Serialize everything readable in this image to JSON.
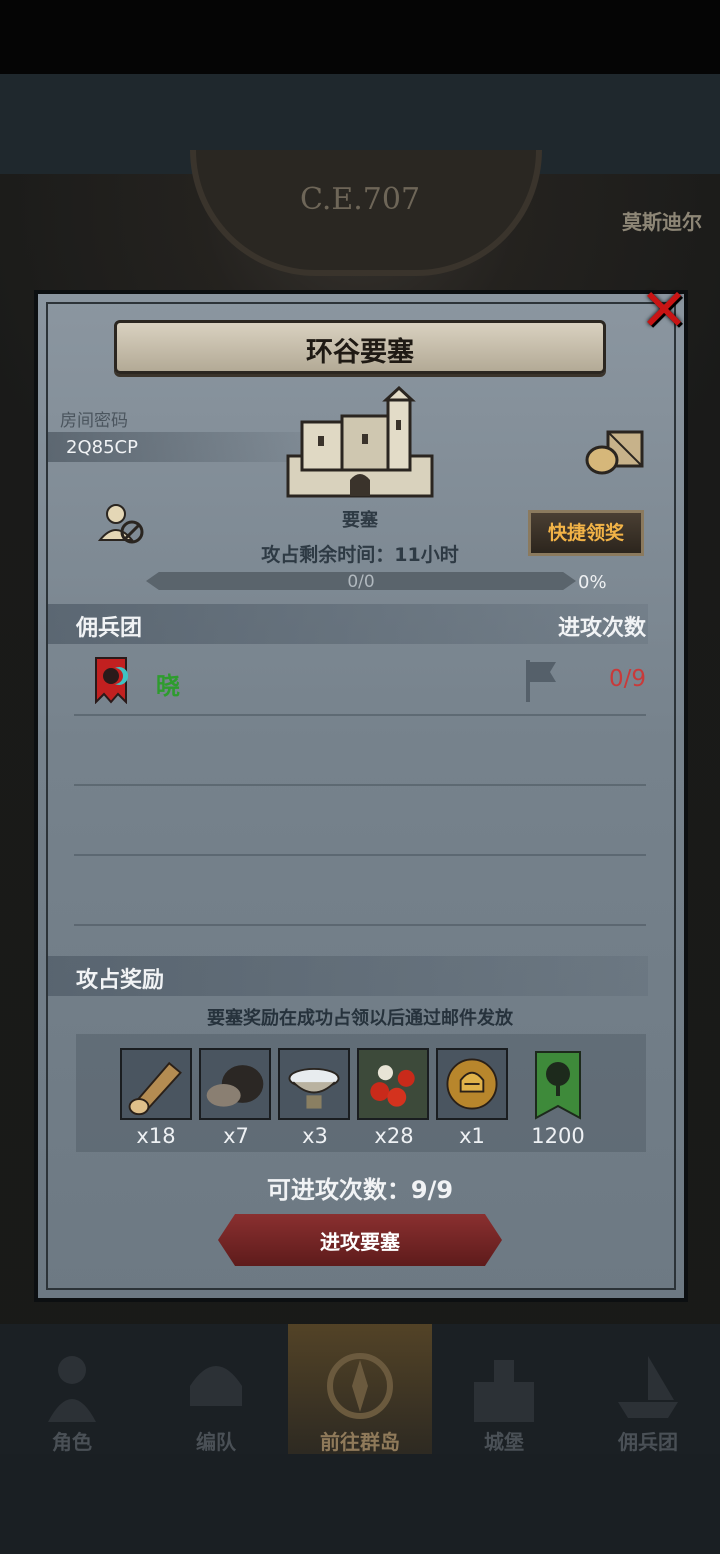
{
  "game_header": {
    "era": "C.E.707",
    "location": "莫斯迪尔"
  },
  "dialog": {
    "title": "环谷要塞",
    "room_password_label": "房间密码",
    "room_password_value": "2Q85CP",
    "castle_name": "要塞",
    "remaining_time": "攻占剩余时间：11小时",
    "quick_claim_label": "快捷领奖",
    "progress": {
      "text": "0/0",
      "percent_text": "0%",
      "fraction": 0
    },
    "mercenary_section_label": "佣兵团",
    "attack_count_label": "进攻次数",
    "mercenaries": [
      {
        "name": "晓",
        "attacks": "0/9"
      }
    ],
    "rewards_section_label": "攻占奖励",
    "rewards_note": "要塞奖励在成功占领以后通过邮件发放",
    "rewards": [
      {
        "icon": "wood-log-icon",
        "qty": "x18"
      },
      {
        "icon": "ore-icon",
        "qty": "x7"
      },
      {
        "icon": "silver-bowl-icon",
        "qty": "x3"
      },
      {
        "icon": "berries-icon",
        "qty": "x28"
      },
      {
        "icon": "gold-helmet-icon",
        "qty": "x1"
      },
      {
        "icon": "tree-banner-icon",
        "qty": "1200"
      }
    ],
    "remaining_attacks": "可进攻次数：9/9",
    "attack_button": "进攻要塞"
  },
  "nav": {
    "items": [
      {
        "label": "角色"
      },
      {
        "label": "编队"
      },
      {
        "label": "前往群岛"
      },
      {
        "label": "城堡"
      },
      {
        "label": "佣兵团"
      }
    ]
  },
  "colors": {
    "panel": "#7f8b95",
    "attack_button": "#7a2828",
    "accent_gold": "#f2b347",
    "merc_green": "#2e9c2e",
    "count_red": "#c93a3a"
  }
}
